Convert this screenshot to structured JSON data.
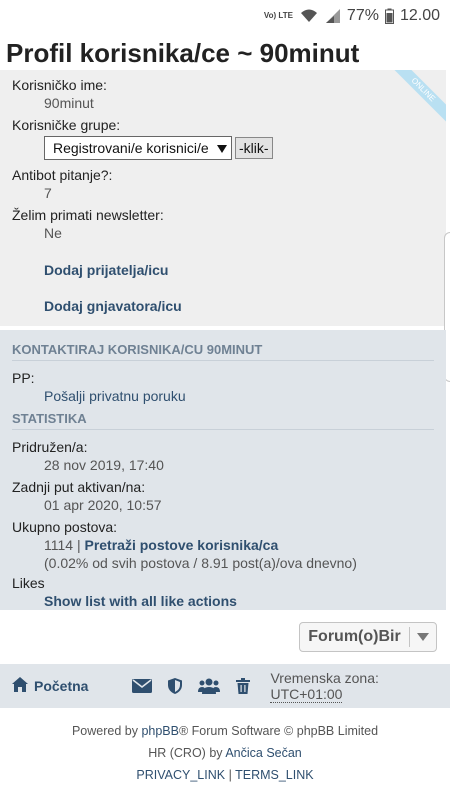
{
  "status_bar": {
    "network_label": "Vo) LTE",
    "battery": "77%",
    "time": "12.00"
  },
  "page_title": "Profil korisnika/ce ~ 90minut",
  "profile": {
    "online_badge": "ONLINE",
    "username_label": "Korisničko ime:",
    "username_value": "90minut",
    "groups_label": "Korisničke grupe:",
    "groups_selected": "Registrovani/e korisnici/e",
    "groups_button": "-klik-",
    "antibot_label": "Antibot pitanje?:",
    "antibot_value": "7",
    "newsletter_label": "Želim primati newsletter:",
    "newsletter_value": "Ne",
    "add_friend": "Dodaj prijatelja/icu",
    "add_foe": "Dodaj gnjavatora/icu"
  },
  "contact": {
    "heading": "KONTAKTIRAJ KORISNIKA/CU 90MINUT",
    "pm_label": "PP:",
    "pm_link": "Pošalji privatnu poruku"
  },
  "stats": {
    "heading": "STATISTIKA",
    "joined_label": "Pridružen/a:",
    "joined_value": "28 nov 2019, 17:40",
    "last_active_label": "Zadnji put aktivan/na:",
    "last_active_value": "01 apr 2020, 10:57",
    "posts_label": "Ukupno postova:",
    "posts_count": "1114 |",
    "posts_search": "Pretraži postove korisnika/ca",
    "posts_ratio": "(0.02% od svih postova / 8.91 post(a)/ova dnevno)",
    "likes_label": "Likes",
    "likes_link": "Show list with all like actions"
  },
  "forum_jump": {
    "label": "Forum(o)Bir"
  },
  "navbar": {
    "home_label": "Početna",
    "timezone_label": "Vremenska zona:",
    "timezone_value": "UTC+01:00",
    "icons": [
      "envelope-icon",
      "shield-icon",
      "users-icon",
      "trash-icon"
    ]
  },
  "footer": {
    "powered_prefix": "Powered by",
    "phpbb_link": "phpBB",
    "powered_suffix": "® Forum Software © phpBB Limited",
    "translation_prefix": "HR (CRO) by",
    "translator_link": "Ančica Sečan",
    "privacy_link": "PRIVACY_LINK",
    "separator": "|",
    "terms_link": "TERMS_LINK"
  },
  "colors": {
    "link": "#2f4f6f",
    "panel_light": "#efefef",
    "panel_blue": "#e0e5ea",
    "section_heading": "#6f8193"
  }
}
